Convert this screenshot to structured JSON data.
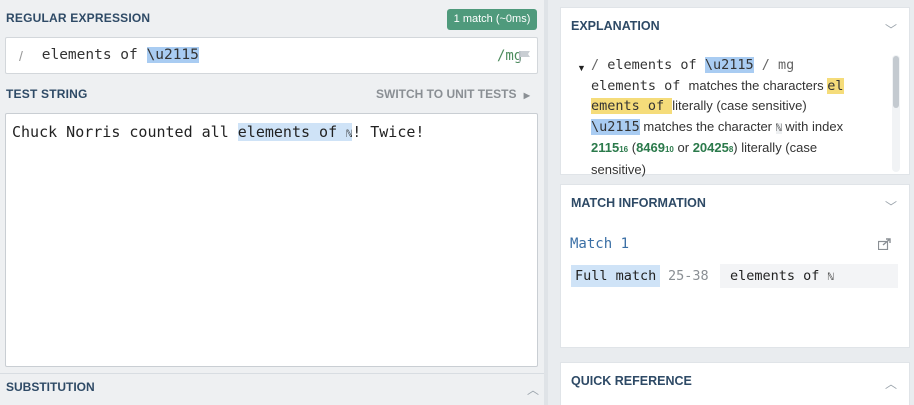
{
  "regex": {
    "section_label": "REGULAR EXPRESSION",
    "match_badge": "1 match (~0ms)",
    "delimiter_open": "/",
    "pattern_prefix": " elements of ",
    "pattern_escape": "\\u2115",
    "flags": "/mg",
    "colors": {
      "badge": "#4f9a7c",
      "highlight": "#a9ccf2"
    }
  },
  "test": {
    "section_label": "TEST STRING",
    "switch_label": "SWITCH TO UNIT TESTS",
    "text_before": "Chuck Norris counted all ",
    "text_match_words": "elements of ",
    "text_match_char": "ℕ",
    "text_after": "! Twice!"
  },
  "substitution": {
    "section_label": "SUBSTITUTION"
  },
  "explanation": {
    "title": "EXPLANATION",
    "line1_delim": "/",
    "line1_prefix": " elements of ",
    "line1_escape": "\\u2115",
    "line1_flags": " / mg",
    "line2_token": "elements of ",
    "line2_text": " matches the characters ",
    "line2_hl_a": "el",
    "line3_hl_b": "ements of ",
    "line3_text": " literally (case sensitive)",
    "line4_token": "\\u2115",
    "line4_text": " matches the character ",
    "line4_char": "ℕ",
    "line4_text2": " with index",
    "line5_hex": "2115",
    "line5_hex_base": "16",
    "line5_dec": "8469",
    "line5_dec_base": "10",
    "line5_or": " or ",
    "line5_oct": "20425",
    "line5_oct_base": "8",
    "line5_text": ") literally (case",
    "line5_paren": " (",
    "line6_text": "sensitive)"
  },
  "match_info": {
    "title": "MATCH INFORMATION",
    "match_title": "Match 1",
    "full_match_label": "Full match",
    "range": "25-38",
    "value_words": "elements of ",
    "value_char": "ℕ"
  },
  "quick_reference": {
    "title": "QUICK REFERENCE"
  },
  "icons": [
    "chevron-up-icon",
    "chevron-down-icon",
    "flag-icon",
    "share-icon",
    "caret-right-icon",
    "expand-triangle-icon"
  ]
}
